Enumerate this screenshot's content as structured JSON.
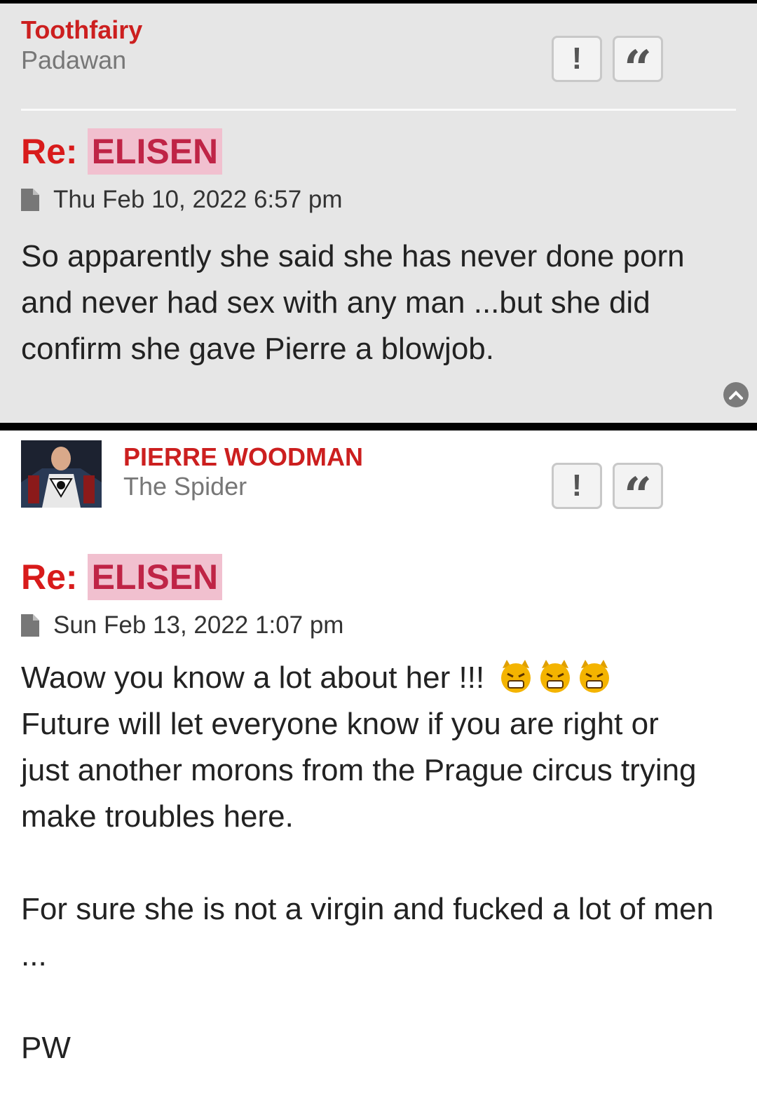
{
  "posts": [
    {
      "author": "Toothfairy",
      "rank": "Padawan",
      "buttons": {
        "report": "!",
        "quote": "“"
      },
      "title_prefix": "Re:",
      "title": "ELISEN",
      "date": "Thu Feb 10, 2022 6:57 pm",
      "body": [
        "So apparently she said she has never done porn and never had sex with any man ...but she did confirm she gave Pierre a blowjob."
      ]
    },
    {
      "author": "PIERRE WOODMAN",
      "rank": "The Spider",
      "buttons": {
        "report": "!",
        "quote": "“"
      },
      "title_prefix": "Re:",
      "title": "ELISEN",
      "date": "Sun Feb 13, 2022 1:07 pm",
      "body": [
        "Waow you know a lot about her !!!",
        "Future will let everyone know if you are right or just another morons from the Prague circus trying make troubles here.",
        "For sure she is not a virgin and fucked a lot of men ...",
        "PW"
      ],
      "emojis": [
        "devil-grin-emoji",
        "devil-grin-emoji",
        "devil-grin-emoji"
      ]
    }
  ],
  "colors": {
    "author": "#cc1f1f",
    "title_bg": "#f1c0cf",
    "title_text": "#bf2446",
    "re": "#d81b1b",
    "post1_bg": "#e6e6e6"
  }
}
